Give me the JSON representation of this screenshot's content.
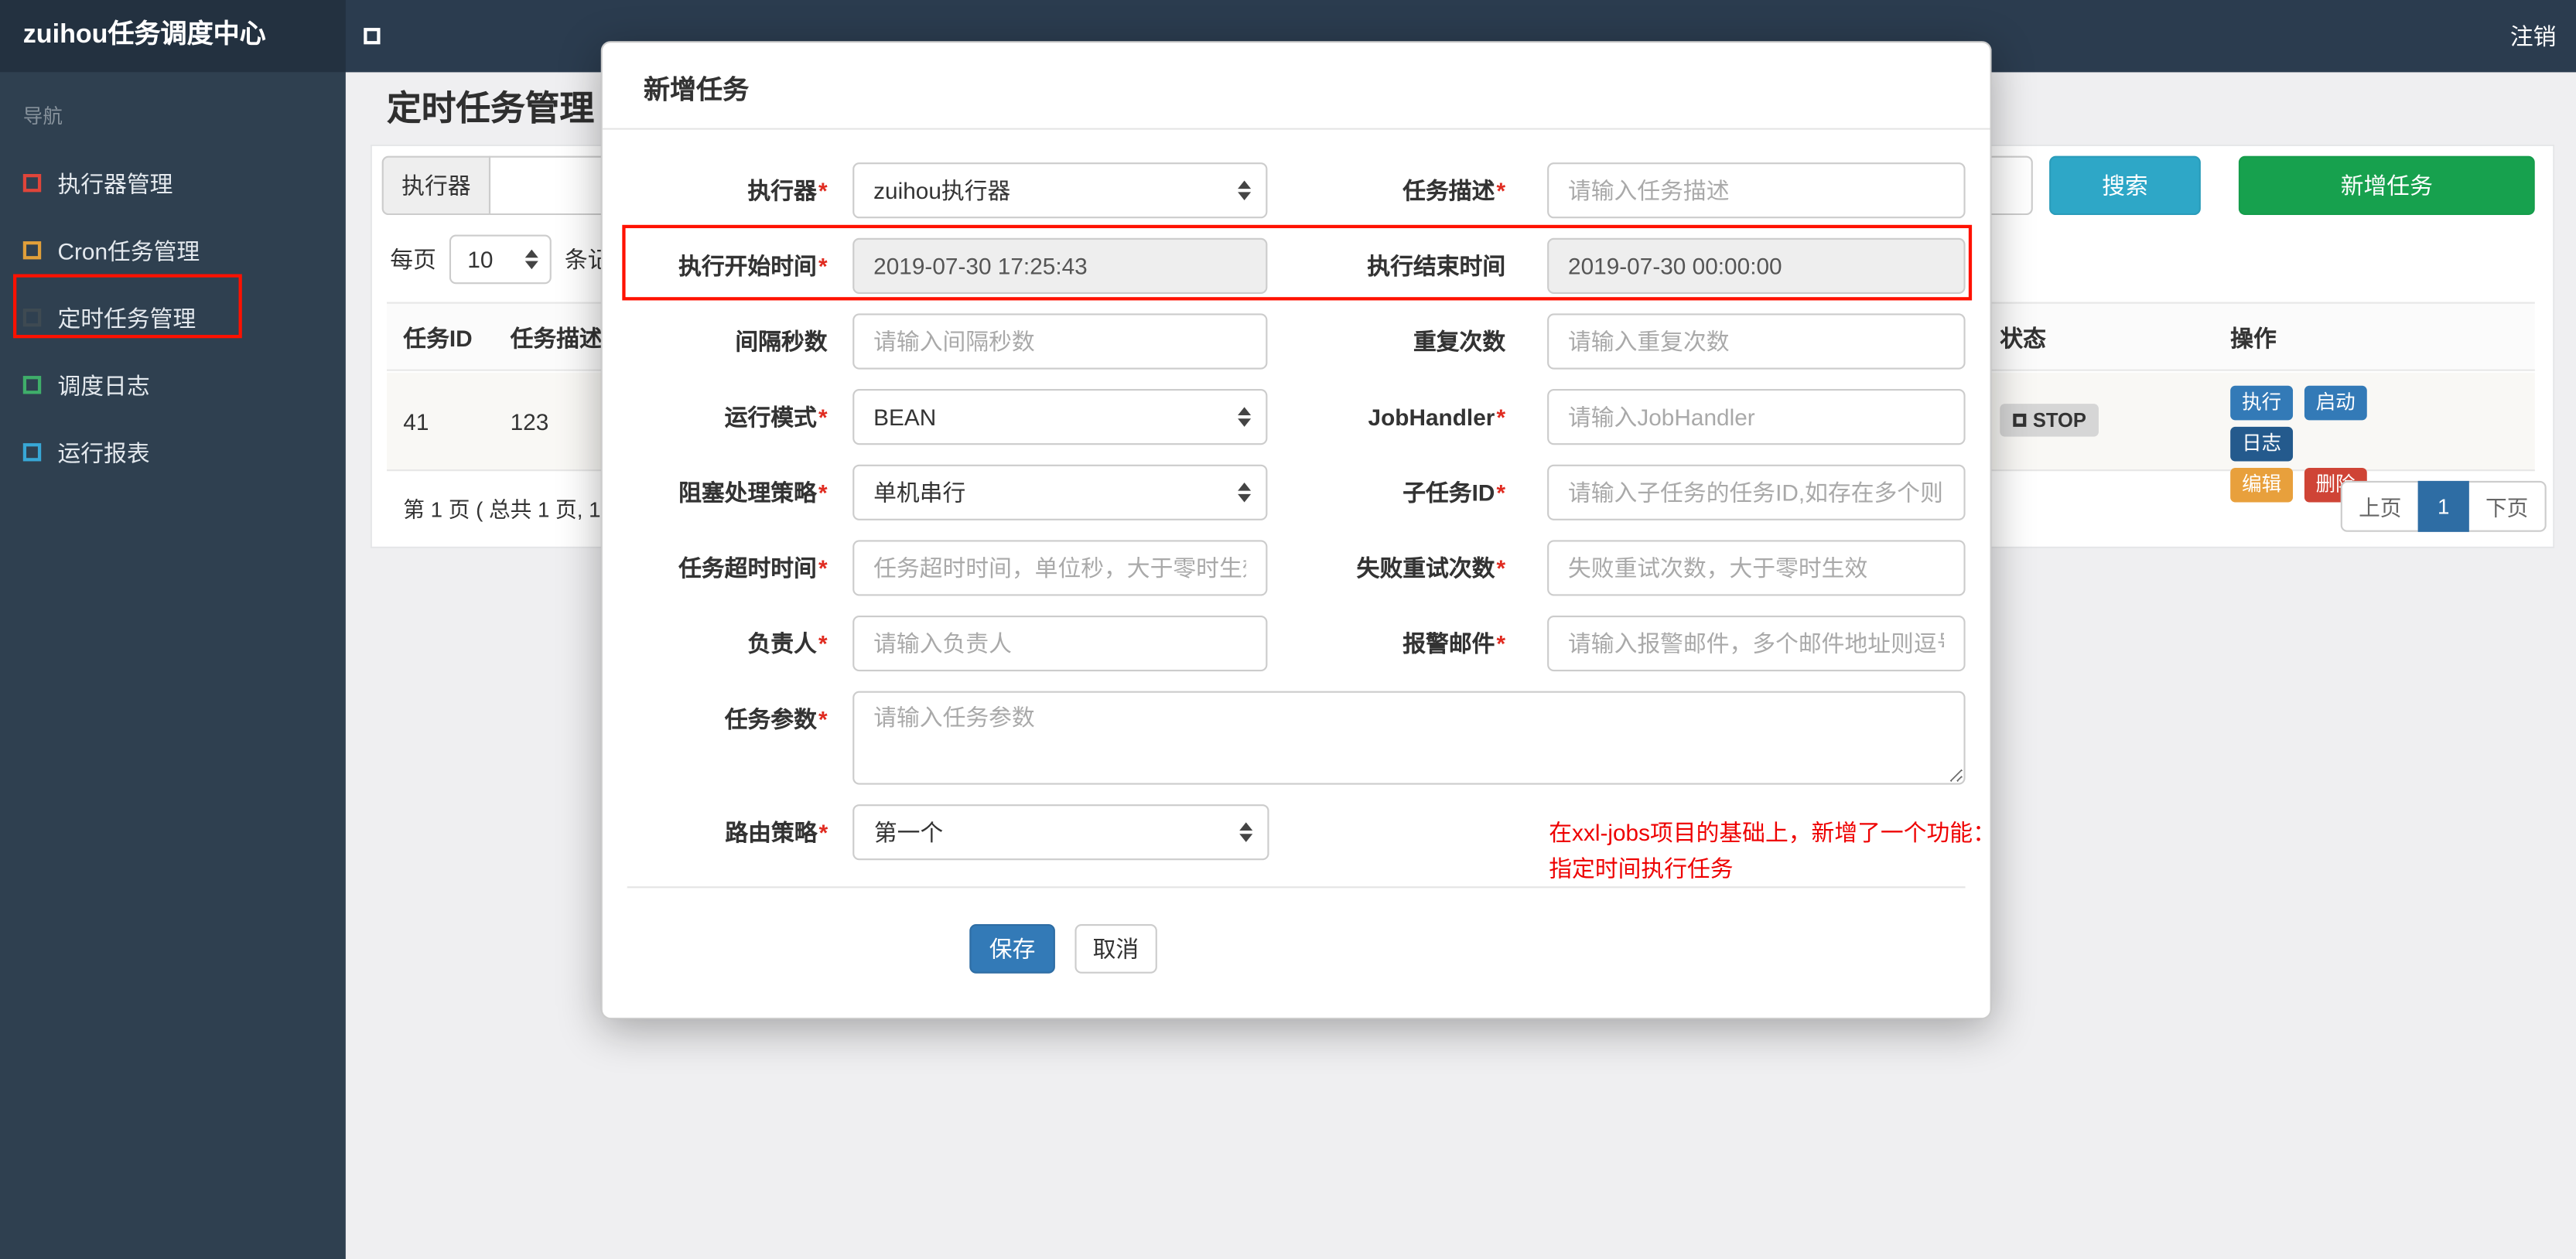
{
  "colors": {
    "topbar_bg": "#2b3c4f",
    "brand_bg": "#233140",
    "sidebar_bg": "#2f4050",
    "search_button": "#2ea7c7",
    "add_button": "#17a14e",
    "save_button": "#337ab7",
    "annotation": "#ff1100",
    "note_text": "#ee0000"
  },
  "topbar": {
    "brand": "zuihou任务调度中心",
    "logout": "注销"
  },
  "sidebar": {
    "nav_label": "导航",
    "items": [
      {
        "label": "执行器管理",
        "icon_style": "border-color:#e0453a"
      },
      {
        "label": "Cron任务管理",
        "icon_style": "border-color:#e09f3a"
      },
      {
        "label": "定时任务管理",
        "icon_style": "border-color:#3e4a52"
      },
      {
        "label": "调度日志",
        "icon_style": "border-color:#3fae6a"
      },
      {
        "label": "运行报表",
        "icon_style": "border-color:#38a7d6"
      }
    ]
  },
  "page": {
    "title": "定时任务管理",
    "filter": {
      "executor_label": "执行器",
      "search": "搜索",
      "add": "新增任务"
    },
    "perpage": {
      "prefix": "每页",
      "value": "10",
      "suffix": "条记录"
    },
    "table": {
      "col_id": "任务ID",
      "col_desc": "任务描述",
      "col_status": "状态",
      "col_action": "操作",
      "row": {
        "id": "41",
        "desc": "123",
        "status": "STOP",
        "btn_run": "执行",
        "btn_start": "启动",
        "btn_log": "日志",
        "btn_edit": "编辑",
        "btn_delete": "删除"
      }
    },
    "pagination": {
      "info": "第 1 页 ( 总共 1 页, 1",
      "prev": "上页",
      "page": "1",
      "next": "下页"
    }
  },
  "modal": {
    "title": "新增任务",
    "required_mark": "*",
    "fields": {
      "executor": {
        "label": "执行器",
        "value": "zuihou执行器"
      },
      "job_desc": {
        "label": "任务描述",
        "placeholder": "请输入任务描述"
      },
      "start_time": {
        "label": "执行开始时间",
        "value": "2019-07-30 17:25:43"
      },
      "end_time": {
        "label": "执行结束时间",
        "value": "2019-07-30 00:00:00"
      },
      "interval": {
        "label": "间隔秒数",
        "placeholder": "请输入间隔秒数"
      },
      "repeat": {
        "label": "重复次数",
        "placeholder": "请输入重复次数"
      },
      "run_mode": {
        "label": "运行模式",
        "value": "BEAN"
      },
      "job_handler": {
        "label": "JobHandler",
        "placeholder": "请输入JobHandler"
      },
      "block_strategy": {
        "label": "阻塞处理策略",
        "value": "单机串行"
      },
      "child_job": {
        "label": "子任务ID",
        "placeholder": "请输入子任务的任务ID,如存在多个则逗"
      },
      "timeout": {
        "label": "任务超时时间",
        "placeholder": "任务超时时间，单位秒，大于零时生效"
      },
      "retry": {
        "label": "失败重试次数",
        "placeholder": "失败重试次数，大于零时生效"
      },
      "owner": {
        "label": "负责人",
        "placeholder": "请输入负责人"
      },
      "alarm_email": {
        "label": "报警邮件",
        "placeholder": "请输入报警邮件，多个邮件地址则逗号分"
      },
      "job_param": {
        "label": "任务参数",
        "placeholder": "请输入任务参数"
      },
      "route_strategy": {
        "label": "路由策略",
        "value": "第一个"
      }
    },
    "note_line1": "在xxl-jobs项目的基础上，新增了一个功能：",
    "note_line2": "指定时间执行任务",
    "save": "保存",
    "cancel": "取消"
  }
}
